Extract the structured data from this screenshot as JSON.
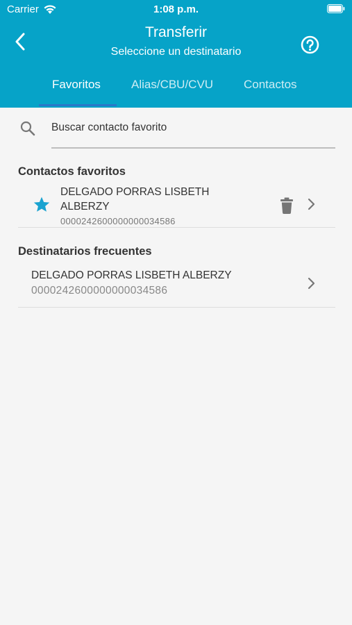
{
  "status_bar": {
    "carrier": "Carrier",
    "time": "1:08 p.m."
  },
  "header": {
    "title": "Transferir",
    "subtitle": "Seleccione un destinatario",
    "background_color": "#06a3c8"
  },
  "tabs": [
    {
      "label": "Favoritos",
      "active": true
    },
    {
      "label": "Alias/CBU/CVU",
      "active": false
    },
    {
      "label": "Contactos",
      "active": false
    }
  ],
  "search": {
    "placeholder": "Buscar contacto favorito"
  },
  "favorites": {
    "section_title": "Contactos favoritos",
    "items": [
      {
        "name": "DELGADO PORRAS LISBETH ALBERZY",
        "account": "0000242600000000034586"
      }
    ]
  },
  "frequent": {
    "section_title": "Destinatarios frecuentes",
    "items": [
      {
        "name": "DELGADO PORRAS LISBETH ALBERZY",
        "account": "0000242600000000034586"
      }
    ]
  },
  "icons": {
    "back": "chevron-left-icon",
    "help": "question-circle-icon",
    "search": "search-icon",
    "favorite": "star-icon",
    "delete": "trash-icon",
    "navigate": "chevron-right-icon"
  },
  "colors": {
    "accent": "#06a3c8",
    "tab_indicator": "#2a78c8",
    "star": "#1aa3d0"
  }
}
